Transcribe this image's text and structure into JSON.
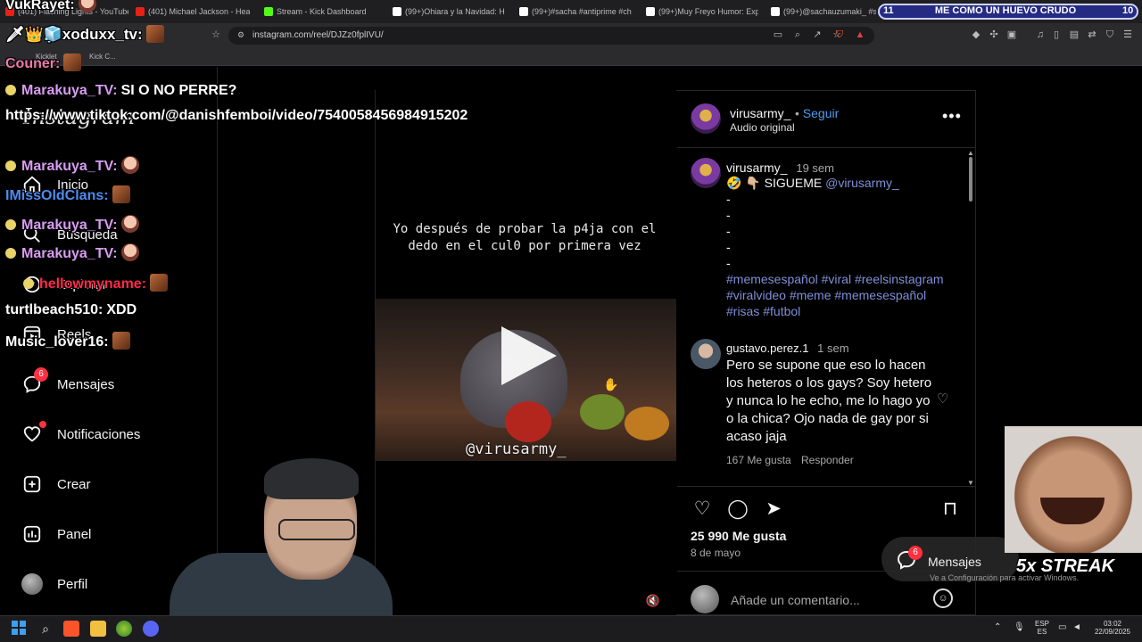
{
  "browser": {
    "tabs": [
      {
        "label": "(401) Flashing Lights - YouTube",
        "favicon": "youtube-icon"
      },
      {
        "label": "(401) Michael Jackson - Heartb",
        "favicon": "youtube-icon"
      },
      {
        "label": "Stream - Kick Dashboard",
        "favicon": "kick-icon"
      },
      {
        "label": "(99+)Ohiara y la Navidad: Hum",
        "favicon": "tiktok-icon"
      },
      {
        "label": "(99+)#sacha #antiprime #chov",
        "favicon": "tiktok-icon"
      },
      {
        "label": "(99+)Muy Freyo Humor: Explor",
        "favicon": "tiktok-icon"
      },
      {
        "label": "(99+)@sachauzumaki_ #sach",
        "favicon": "tiktok-icon"
      }
    ],
    "url": "instagram.com/reel/DJZz0fplIVU/",
    "bookmarks": [
      "Kicklet",
      "Kick C..."
    ]
  },
  "banner": {
    "left_number": "11",
    "title": "ME COMO UN HUEVO CRUDO",
    "right_number": "10"
  },
  "instagram": {
    "logo": "Instagram",
    "nav": [
      {
        "key": "inicio",
        "label": "Inicio",
        "icon": "home-icon"
      },
      {
        "key": "busqueda",
        "label": "Búsqueda",
        "icon": "search-icon"
      },
      {
        "key": "explorar",
        "label": "Explorar",
        "icon": "compass-icon"
      },
      {
        "key": "reels",
        "label": "Reels",
        "icon": "reels-icon"
      },
      {
        "key": "mensajes",
        "label": "Mensajes",
        "icon": "messenger-icon",
        "badge": "6"
      },
      {
        "key": "notificaciones",
        "label": "Notificaciones",
        "icon": "heart-icon"
      },
      {
        "key": "crear",
        "label": "Crear",
        "icon": "plus-square-icon"
      },
      {
        "key": "panel",
        "label": "Panel",
        "icon": "chart-icon"
      },
      {
        "key": "perfil",
        "label": "Perfil",
        "icon": "avatar"
      }
    ]
  },
  "video": {
    "caption": "Yo después de probar la p4ja con el dedo en el cul0 por primera vez",
    "watermark": "@virusarmy_"
  },
  "post": {
    "username": "virusarmy_",
    "follow_label": "Seguir",
    "separator": "•",
    "audio": "Audio original",
    "body": {
      "username": "virusarmy_",
      "time": "19 sem",
      "first_line": "🤣 👇🏼 SIGUEME",
      "mention": "@virusarmy_",
      "dashes": [
        "-",
        "-",
        "-",
        "-",
        "-"
      ],
      "hashtags": "#memesespañol #viral #reelsinstagram #viralvideo #meme #memesespañol #risas #futbol"
    },
    "comment": {
      "username": "gustavo.perez.1",
      "time": "1 sem",
      "text": "Pero se supone que eso lo hacen los heteros o los gays? Soy hetero y nunca lo he echo, me lo hago yo o la chica? Ojo nada de gay por si acaso jaja",
      "likes": "167 Me gusta",
      "reply_label": "Responder"
    },
    "likes": "25 990 Me gusta",
    "date": "8 de mayo",
    "comment_placeholder": "Añade un comentario..."
  },
  "chat": [
    {
      "user": "VukRayet:",
      "text": "",
      "color": "#ffffff",
      "emote": "sticker"
    },
    {
      "user": "xoduxx_tv:",
      "text": "",
      "color": "#ffffff",
      "emote": "emote",
      "prefix": "🗡👑🧊"
    },
    {
      "user": "Couner:",
      "text": "",
      "color": "#f07aa8",
      "emote": "emote"
    },
    {
      "user": "Marakuya_TV:",
      "text": "SI O NO PERRE?",
      "color": "#d89cf2",
      "emote": ""
    },
    {
      "user": "",
      "text": "https://www.tiktok.com/@danishfemboi/video/7540058456984915202",
      "color": "#ffffff",
      "emote": ""
    },
    {
      "user": "Marakuya_TV:",
      "text": "",
      "color": "#d89cf2",
      "emote": "sticker"
    },
    {
      "user": "IMissOldClans:",
      "text": "",
      "color": "#4b8cf0",
      "emote": "emote"
    },
    {
      "user": "Marakuya_TV:",
      "text": "",
      "color": "#d89cf2",
      "emote": "sticker"
    },
    {
      "user": "Marakuya_TV:",
      "text": "",
      "color": "#d89cf2",
      "emote": "sticker"
    },
    {
      "user": "hellowmyname:",
      "text": "",
      "color": "#ff2a4a",
      "emote": "emote"
    },
    {
      "user": "turtlbeach510:",
      "text": "XDD",
      "color": "#ffffff",
      "emote": ""
    },
    {
      "user": "Music_lover16:",
      "text": "",
      "color": "#ffffff",
      "emote": "emote"
    }
  ],
  "overlays": {
    "streak": "5x STREAK",
    "toast_label": "Mensajes",
    "toast_badge": "6",
    "windows_notice": "Ve a Configuración para activar Windows."
  },
  "taskbar": {
    "lang_top": "ESP",
    "lang_bottom": "ES",
    "time": "03:02",
    "date": "22/09/2025"
  },
  "colors": {
    "ig_blue": "#4c9cf0",
    "ig_red": "#ff3040",
    "banner_bg": "#252b82"
  }
}
